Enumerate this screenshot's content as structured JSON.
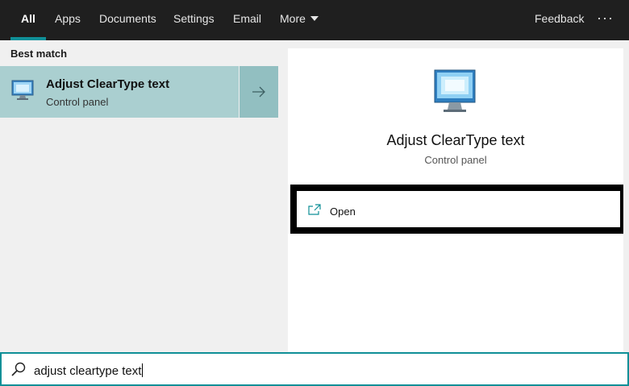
{
  "tabs": [
    {
      "label": "All",
      "active": true
    },
    {
      "label": "Apps"
    },
    {
      "label": "Documents"
    },
    {
      "label": "Settings"
    },
    {
      "label": "Email"
    },
    {
      "label": "More"
    }
  ],
  "header": {
    "feedback_label": "Feedback",
    "more_options_label": "···"
  },
  "best_match": {
    "heading": "Best match",
    "item": {
      "title": "Adjust ClearType text",
      "subtitle": "Control panel",
      "icon": "monitor-icon"
    }
  },
  "detail": {
    "title": "Adjust ClearType text",
    "subtitle": "Control panel",
    "icon": "monitor-icon",
    "actions": [
      {
        "label": "Open",
        "icon": "open-icon"
      }
    ]
  },
  "search": {
    "value": "adjust cleartype text"
  },
  "colors": {
    "accent": "#0f8f97",
    "selected_bg": "#aacfd0",
    "topbar_bg": "#1f1f1f"
  }
}
